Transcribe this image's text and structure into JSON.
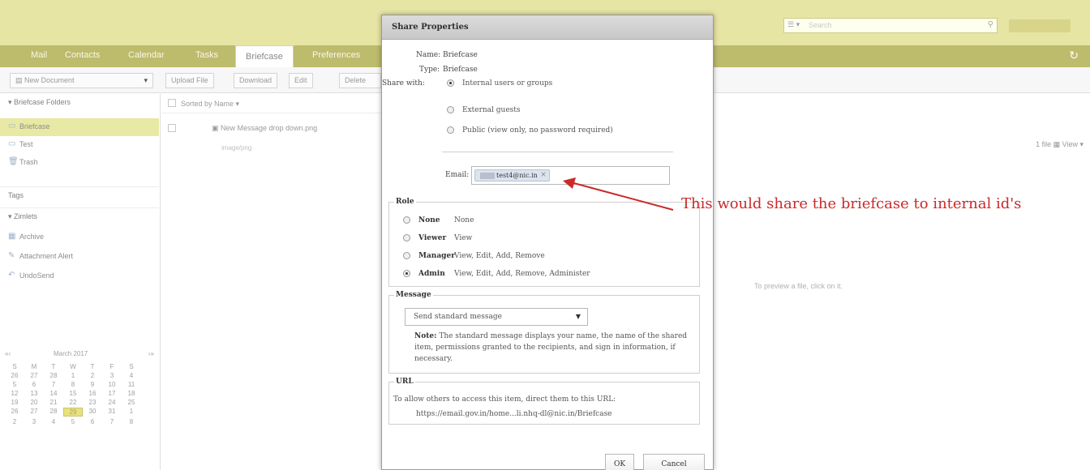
{
  "header": {
    "search_type": "▾",
    "search_placeholder": "Search",
    "search_icon": "search-icon",
    "refresh_icon": "refresh-icon"
  },
  "tabs": [
    {
      "label": "Mail"
    },
    {
      "label": "Contacts"
    },
    {
      "label": "Calendar"
    },
    {
      "label": "Tasks"
    },
    {
      "label": "Briefcase",
      "active": true
    },
    {
      "label": "Preferences"
    }
  ],
  "toolbar": {
    "new_document": "New Document",
    "upload_file": "Upload File",
    "download": "Download",
    "edit": "Edit",
    "delete": "Delete",
    "count": "1 file",
    "view": "View"
  },
  "sidebar": {
    "folders_header": "Briefcase Folders",
    "folders": [
      {
        "label": "Briefcase",
        "icon": "folder-icon",
        "selected": true
      },
      {
        "label": "Test",
        "icon": "folder-icon"
      },
      {
        "label": "Trash",
        "icon": "trash-icon"
      }
    ],
    "tags_header": "Tags",
    "zimlets_header": "Zimlets",
    "zimlets": [
      {
        "label": "Archive",
        "icon": "archive-icon"
      },
      {
        "label": "Attachment Alert",
        "icon": "paperclip-icon"
      },
      {
        "label": "UndoSend",
        "icon": "undo-icon"
      }
    ]
  },
  "calendar": {
    "month": "March 2017",
    "weekdays": [
      "S",
      "M",
      "T",
      "W",
      "T",
      "F",
      "S"
    ],
    "days": [
      "26",
      "27",
      "28",
      "1",
      "2",
      "3",
      "4",
      "5",
      "6",
      "7",
      "8",
      "9",
      "10",
      "11",
      "12",
      "13",
      "14",
      "15",
      "16",
      "17",
      "18",
      "19",
      "20",
      "21",
      "22",
      "23",
      "24",
      "25",
      "26",
      "27",
      "28",
      "29",
      "30",
      "31",
      "1",
      "2",
      "3",
      "4",
      "5",
      "6",
      "7",
      "8"
    ],
    "today": "29"
  },
  "list": {
    "sort_label": "Sorted by Name",
    "file_name": "New Message drop down.png",
    "file_meta": "image/png"
  },
  "preview": {
    "hint": "To preview a file, click on it."
  },
  "dialog": {
    "title": "Share Properties",
    "name_label": "Name:",
    "name_value": "Briefcase",
    "type_label": "Type:",
    "type_value": "Briefcase",
    "share_with_label": "Share with:",
    "share_options": [
      {
        "label": "Internal users or groups",
        "checked": true
      },
      {
        "label": "External guests",
        "checked": false
      },
      {
        "label": "Public (view only, no password required)",
        "checked": false
      }
    ],
    "email_label": "Email:",
    "email_chip": "test4@nic.in",
    "role_legend": "Role",
    "roles": [
      {
        "name": "None",
        "desc": "None",
        "checked": false
      },
      {
        "name": "Viewer",
        "desc": "View",
        "checked": false
      },
      {
        "name": "Manager",
        "desc": "View, Edit, Add, Remove",
        "checked": false
      },
      {
        "name": "Admin",
        "desc": "View, Edit, Add, Remove, Administer",
        "checked": true
      }
    ],
    "message_legend": "Message",
    "message_select": "Send standard message",
    "note_label": "Note:",
    "note_text": "The standard message displays your name, the name of the shared item, permissions granted to the recipients, and sign in information, if necessary.",
    "url_legend": "URL",
    "url_text": "To allow others to access this item, direct them to this URL:",
    "url_value": "https://email.gov.in/home...li.nhq-dl@nic.in/Briefcase",
    "ok_label": "OK",
    "cancel_label": "Cancel"
  },
  "annotation": {
    "text": "This would share the briefcase to internal id's",
    "color": "#c92a2a"
  }
}
